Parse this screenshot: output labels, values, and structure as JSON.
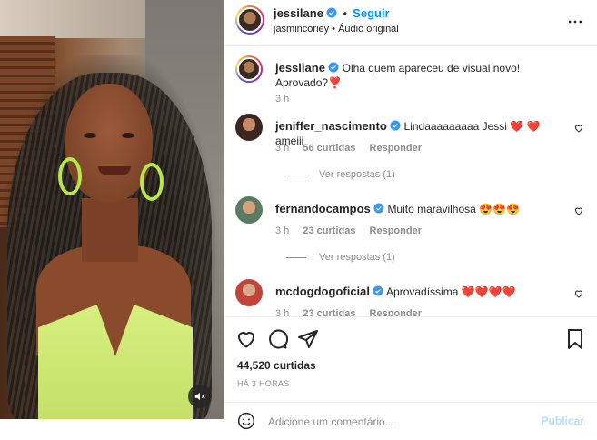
{
  "post": {
    "author": "jessilane",
    "follow_label": "Seguir",
    "separator": "•",
    "audio": "jasmincoriey • Áudio original"
  },
  "caption": {
    "username": "jessilane",
    "text": "Olha quem apareceu de visual novo! Aprovado?",
    "emoji": "❣️",
    "time": "3 h"
  },
  "comments": [
    {
      "username": "jeniffer_nascimento",
      "text": "Lindaaaaaaaaa Jessi ❤️ ❤️  ameiii",
      "time": "3 h",
      "likes": "56 curtidas",
      "reply": "Responder",
      "view_replies": "Ver respostas (1)"
    },
    {
      "username": "fernandocampos",
      "text": "Muito maravilhosa 😍😍😍",
      "time": "3 h",
      "likes": "23 curtidas",
      "reply": "Responder",
      "view_replies": "Ver respostas (1)"
    },
    {
      "username": "mcdogdogoficial",
      "text": "Aprovadíssima ❤️❤️❤️❤️",
      "time": "3 h",
      "likes": "23 curtidas",
      "reply": "Responder"
    }
  ],
  "stats": {
    "likes": "44,520 curtidas",
    "time": "HÁ 3 HORAS"
  },
  "add_comment": {
    "placeholder": "Adicione um comentário...",
    "publish": "Publicar"
  },
  "icons": {
    "verified": "verified-badge-icon",
    "more": "more-options-icon",
    "like": "heart-icon",
    "comment": "comment-icon",
    "share": "share-icon",
    "save": "bookmark-icon",
    "emoji": "emoji-icon",
    "mute": "muted-speaker-icon"
  },
  "colors": {
    "accent": "#0095f6",
    "verified": "#3897f0",
    "heart": "#ed1a3b",
    "muted_text": "#8e8e8e",
    "publish_disabled": "#b2dffc"
  }
}
